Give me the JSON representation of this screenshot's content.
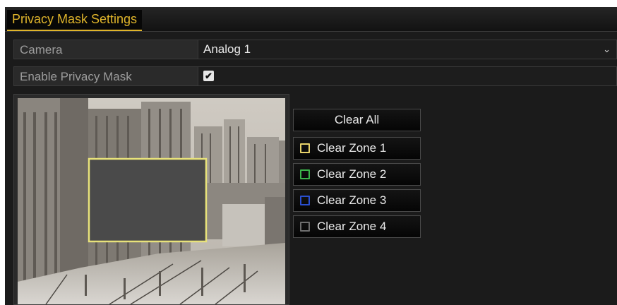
{
  "title": "Privacy Mask Settings",
  "camera": {
    "label": "Camera",
    "value": "Analog 1"
  },
  "enable_privacy_mask": {
    "label": "Enable Privacy Mask",
    "checked": true,
    "check_glyph": "✔"
  },
  "buttons": {
    "clear_all": "Clear All",
    "zones": [
      {
        "label": "Clear Zone 1",
        "color": "#e8d36a"
      },
      {
        "label": "Clear Zone 2",
        "color": "#3bb54a"
      },
      {
        "label": "Clear Zone 3",
        "color": "#2a4fd0"
      },
      {
        "label": "Clear Zone 4",
        "color": "#6e6e6e"
      }
    ]
  },
  "icons": {
    "dropdown": "chevron-down-icon",
    "checkbox": "checkmark-icon"
  },
  "accent_color": "#e0b52b"
}
